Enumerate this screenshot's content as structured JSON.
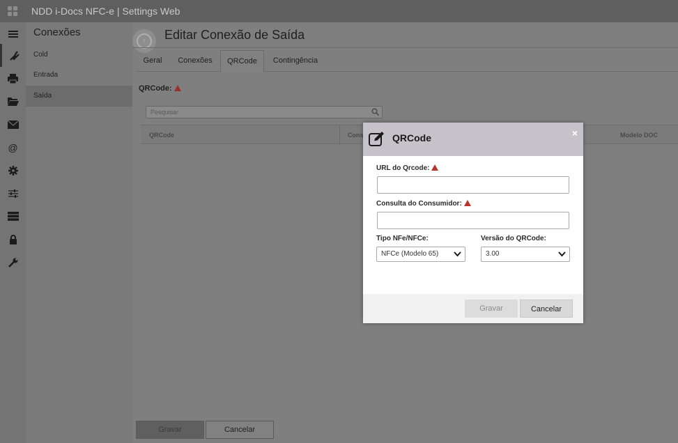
{
  "app": {
    "title": "NDD i-Docs NFC-e | Settings Web"
  },
  "iconbar": {
    "items": [
      {
        "icon": "menu-icon",
        "glyph": "☰"
      },
      {
        "icon": "plug-icon",
        "glyph": "🔌"
      },
      {
        "icon": "printer-icon",
        "glyph": "⎙"
      },
      {
        "icon": "folder-icon",
        "glyph": "▰"
      },
      {
        "icon": "envelope-icon",
        "glyph": "✉"
      },
      {
        "icon": "at-icon",
        "glyph": "@"
      },
      {
        "icon": "gear-icon",
        "glyph": "⚙"
      },
      {
        "icon": "sliders-icon",
        "glyph": "≡"
      },
      {
        "icon": "server-icon",
        "glyph": "▤"
      },
      {
        "icon": "lock-icon",
        "glyph": "🔒"
      },
      {
        "icon": "wrench-icon",
        "glyph": "🔧"
      }
    ]
  },
  "sidebar": {
    "title": "Conexões",
    "items": [
      {
        "label": "Cold"
      },
      {
        "label": "Entrada"
      },
      {
        "label": "Saída"
      }
    ]
  },
  "main": {
    "page_title": "Editar Conexão de Saída",
    "tabs": [
      {
        "label": "Geral"
      },
      {
        "label": "Conexões"
      },
      {
        "label": "QRCode"
      },
      {
        "label": "Contingência"
      }
    ],
    "section_label": "QRCode:",
    "search": {
      "placeholder": "Pesquisar"
    },
    "table": {
      "columns": [
        "QRCode",
        "Cons",
        "Modelo DOC"
      ]
    },
    "buttons": {
      "save": "Gravar",
      "cancel": "Cancelar"
    }
  },
  "modal": {
    "title": "QRCode",
    "close": "×",
    "url_label": "URL do Qrcode:",
    "url_value": "",
    "consulta_label": "Consulta do Consumidor:",
    "consulta_value": "",
    "tipo_label": "Tipo NFe/NFCe:",
    "tipo_value": "NFCe (Modelo 65)",
    "versao_label": "Versão do QRCode:",
    "versao_value": "3.00",
    "save_label": "Gravar",
    "cancel_label": "Cancelar"
  },
  "colors": {
    "warning": "#b8332d",
    "overlay": "#7f7f7f",
    "modal_header": "#c5c3c9"
  }
}
